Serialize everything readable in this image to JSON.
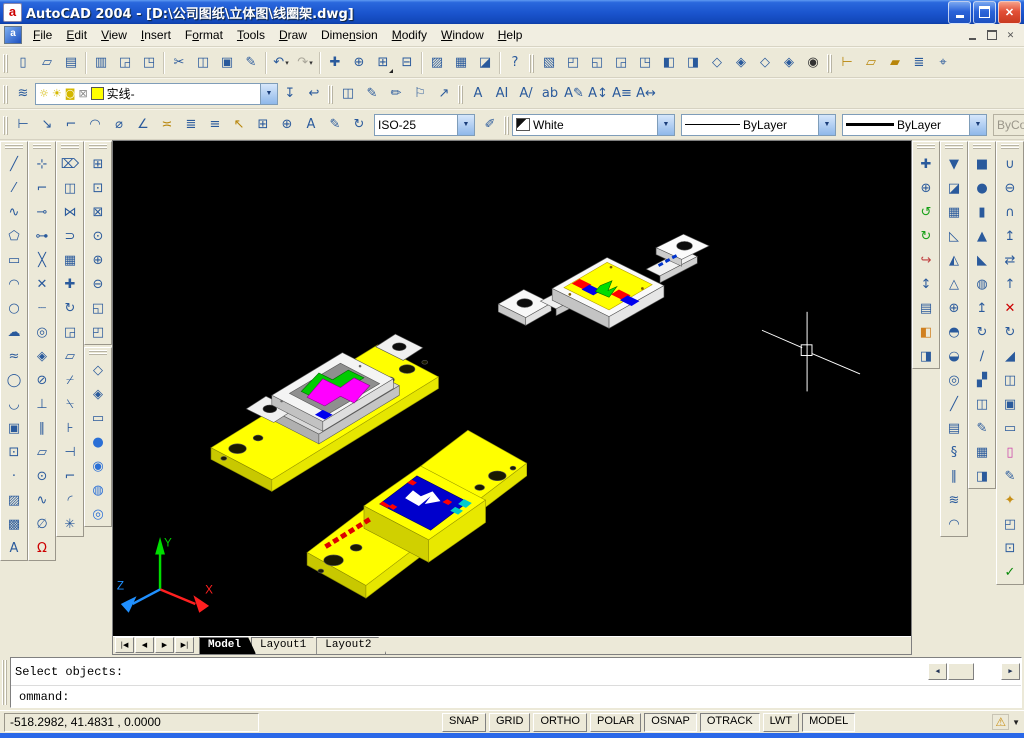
{
  "window": {
    "app_icon_letter": "a",
    "title": "AutoCAD 2004 - [D:\\公司图纸\\立体图\\线圈架.dwg]",
    "controls": {
      "minimize": "minimize",
      "restore": "restore",
      "close": "close"
    }
  },
  "menus": [
    {
      "label": "File",
      "m": 0
    },
    {
      "label": "Edit",
      "m": 0
    },
    {
      "label": "View",
      "m": 0
    },
    {
      "label": "Insert",
      "m": 0
    },
    {
      "label": "Format",
      "m": 1
    },
    {
      "label": "Tools",
      "m": 0
    },
    {
      "label": "Draw",
      "m": 0
    },
    {
      "label": "Dimension",
      "m": 4
    },
    {
      "label": "Modify",
      "m": 0
    },
    {
      "label": "Window",
      "m": 0
    },
    {
      "label": "Help",
      "m": 0
    }
  ],
  "colors": {
    "canvas_bg": "#000000",
    "toolbar_bg": "#ECE9D8",
    "titlebar_blue": "#1A54CD",
    "taskbar_blue": "#2A68E8",
    "model_yellow": "#FFFF00",
    "model_white": "#F5F5F5",
    "model_blue": "#0000CC",
    "model_green": "#00CC00",
    "model_magenta": "#FF00FF",
    "model_red": "#FF0000",
    "ucs_x": "#FF2020",
    "ucs_y": "#00DD00",
    "ucs_z": "#2090FF"
  },
  "toolbars": {
    "standard": [
      {
        "n": "new",
        "g": "▯"
      },
      {
        "n": "open",
        "g": "▱"
      },
      {
        "n": "save",
        "g": "▤"
      },
      {
        "sep": 1
      },
      {
        "n": "plot",
        "g": "▥"
      },
      {
        "n": "plot-preview",
        "g": "◲"
      },
      {
        "n": "publish",
        "g": "◳"
      },
      {
        "sep": 1
      },
      {
        "n": "cut",
        "g": "✂"
      },
      {
        "n": "copy",
        "g": "◫"
      },
      {
        "n": "paste",
        "g": "▣"
      },
      {
        "n": "match-properties",
        "g": "✎"
      },
      {
        "sep": 1
      },
      {
        "n": "undo",
        "g": "↶",
        "dd": 1
      },
      {
        "n": "redo",
        "g": "↷",
        "dd": 1,
        "dis": 1
      },
      {
        "sep": 1
      },
      {
        "n": "pan-realtime",
        "g": "✚"
      },
      {
        "n": "zoom-realtime",
        "g": "⊕"
      },
      {
        "n": "zoom-window",
        "g": "⊞",
        "fly": 1
      },
      {
        "n": "zoom-previous",
        "g": "⊟"
      },
      {
        "sep": 1
      },
      {
        "n": "properties-palette",
        "g": "▨"
      },
      {
        "n": "designcenter",
        "g": "▦"
      },
      {
        "n": "tool-palettes",
        "g": "◪"
      },
      {
        "sep": 1
      },
      {
        "n": "help",
        "g": "?"
      }
    ],
    "views": [
      {
        "n": "named-views",
        "g": "▧"
      },
      {
        "n": "top-view",
        "g": "◰"
      },
      {
        "n": "bottom-view",
        "g": "◱"
      },
      {
        "n": "left-view",
        "g": "◲"
      },
      {
        "n": "right-view",
        "g": "◳"
      },
      {
        "n": "front-view",
        "g": "◧"
      },
      {
        "n": "back-view",
        "g": "◨"
      },
      {
        "n": "sw-isometric-view",
        "g": "◇"
      },
      {
        "n": "se-isometric-view",
        "g": "◈"
      },
      {
        "n": "ne-isometric-view",
        "g": "◇"
      },
      {
        "n": "nw-isometric-view",
        "g": "◈"
      },
      {
        "n": "camera",
        "g": "◉",
        "c": "#333333"
      }
    ],
    "inquiry": [
      {
        "n": "distance",
        "g": "⊢",
        "c": "#b8860b"
      },
      {
        "n": "area",
        "g": "▱",
        "c": "#b8860b"
      },
      {
        "n": "mass-properties",
        "g": "▰",
        "c": "#b8860b"
      },
      {
        "n": "list",
        "g": "≣"
      },
      {
        "n": "locate-point",
        "g": "⌖"
      }
    ],
    "layers_left": [
      {
        "n": "layer-properties-manager",
        "g": "≋"
      }
    ],
    "layers_right": [
      {
        "n": "make-object-layer-current",
        "g": "↧"
      },
      {
        "n": "layer-previous",
        "g": "↩"
      }
    ],
    "propref": [
      {
        "n": "object-properties",
        "g": "◫"
      },
      {
        "n": "edit-attribute",
        "g": "✎"
      },
      {
        "n": "block-attribute-manager",
        "g": "✏"
      },
      {
        "n": "define-attribute",
        "g": "⚐"
      },
      {
        "n": "synchronize-attributes",
        "g": "↗"
      }
    ],
    "text": [
      {
        "n": "multiline-text",
        "g": "A"
      },
      {
        "n": "single-line-text",
        "g": "AI"
      },
      {
        "n": "edit-text",
        "g": "A/"
      },
      {
        "n": "find-and-replace",
        "g": "ab"
      },
      {
        "n": "text-style",
        "g": "A✎"
      },
      {
        "n": "scale-text",
        "g": "A↕"
      },
      {
        "n": "justify-text",
        "g": "A≡"
      },
      {
        "n": "convert-distance",
        "g": "A↔"
      }
    ],
    "dimension": [
      {
        "n": "linear-dimension",
        "g": "⊢"
      },
      {
        "n": "aligned-dimension",
        "g": "↘"
      },
      {
        "n": "ordinate-dimension",
        "g": "⌐"
      },
      {
        "n": "radius-dimension",
        "g": "◠"
      },
      {
        "n": "diameter-dimension",
        "g": "⌀"
      },
      {
        "n": "angular-dimension",
        "g": "∠"
      },
      {
        "n": "quick-dimension",
        "g": "≍",
        "c": "#b8860b"
      },
      {
        "n": "baseline-dimension",
        "g": "≣"
      },
      {
        "n": "continue-dimension",
        "g": "≡"
      },
      {
        "n": "quick-leader",
        "g": "↖",
        "c": "#b8860b"
      },
      {
        "n": "tolerance",
        "g": "⊞"
      },
      {
        "n": "center-mark",
        "g": "⊕"
      },
      {
        "n": "dimension-edit",
        "g": "A"
      },
      {
        "n": "dimension-text-edit",
        "g": "✎"
      },
      {
        "n": "dimension-update",
        "g": "↻"
      }
    ],
    "dim_style_btn": [
      {
        "n": "dimension-style",
        "g": "✐"
      }
    ],
    "draw": [
      {
        "n": "line",
        "g": "╱"
      },
      {
        "n": "construction-line",
        "g": "⁄"
      },
      {
        "n": "polyline",
        "g": "∿"
      },
      {
        "n": "polygon",
        "g": "⬠"
      },
      {
        "n": "rectangle",
        "g": "▭"
      },
      {
        "n": "arc",
        "g": "◠"
      },
      {
        "n": "circle",
        "g": "○"
      },
      {
        "n": "revision-cloud",
        "g": "☁"
      },
      {
        "n": "spline",
        "g": "≈"
      },
      {
        "n": "ellipse",
        "g": "◯"
      },
      {
        "n": "ellipse-arc",
        "g": "◡"
      },
      {
        "n": "insert-block",
        "g": "▣"
      },
      {
        "n": "make-block",
        "g": "⊡"
      },
      {
        "n": "point",
        "g": "·"
      },
      {
        "n": "hatch",
        "g": "▨"
      },
      {
        "n": "region",
        "g": "▩"
      },
      {
        "n": "multiline-text-draw",
        "g": "A"
      }
    ],
    "osnap": [
      {
        "n": "temporary-tracking-point",
        "g": "⊹"
      },
      {
        "n": "snap-from",
        "g": "⌐"
      },
      {
        "n": "snap-endpoint",
        "g": "⊸"
      },
      {
        "n": "snap-midpoint",
        "g": "⊶"
      },
      {
        "n": "snap-intersection",
        "g": "╳"
      },
      {
        "n": "snap-apparent-intersection",
        "g": "✕"
      },
      {
        "n": "snap-extension",
        "g": "┈"
      },
      {
        "n": "snap-center",
        "g": "◎"
      },
      {
        "n": "snap-quadrant",
        "g": "◈"
      },
      {
        "n": "snap-tangent",
        "g": "⊘"
      },
      {
        "n": "snap-perpendicular",
        "g": "⊥"
      },
      {
        "n": "snap-parallel",
        "g": "∥"
      },
      {
        "n": "snap-insertion",
        "g": "▱"
      },
      {
        "n": "snap-node",
        "g": "⊙"
      },
      {
        "n": "snap-nearest",
        "g": "∿"
      },
      {
        "n": "snap-none",
        "g": "∅"
      },
      {
        "n": "osnap-settings",
        "g": "Ω",
        "c": "#cc0000"
      }
    ],
    "modify": [
      {
        "n": "erase",
        "g": "⌦"
      },
      {
        "n": "copy-object",
        "g": "◫"
      },
      {
        "n": "mirror",
        "g": "⋈"
      },
      {
        "n": "offset",
        "g": "⊃"
      },
      {
        "n": "array",
        "g": "▦"
      },
      {
        "n": "move",
        "g": "✚"
      },
      {
        "n": "rotate",
        "g": "↻"
      },
      {
        "n": "scale",
        "g": "◲"
      },
      {
        "n": "stretch",
        "g": "▱"
      },
      {
        "n": "trim",
        "g": "⌿"
      },
      {
        "n": "extend",
        "g": "⍀"
      },
      {
        "n": "break-at-point",
        "g": "⊦"
      },
      {
        "n": "break",
        "g": "⊣"
      },
      {
        "n": "chamfer",
        "g": "⌐"
      },
      {
        "n": "fillet",
        "g": "◜"
      },
      {
        "n": "explode",
        "g": "✳"
      }
    ],
    "zoom": [
      {
        "n": "zoom-window-tool",
        "g": "⊞"
      },
      {
        "n": "zoom-dynamic",
        "g": "⊡"
      },
      {
        "n": "zoom-scale",
        "g": "⊠"
      },
      {
        "n": "zoom-center",
        "g": "⊙"
      },
      {
        "n": "zoom-in",
        "g": "⊕"
      },
      {
        "n": "zoom-out",
        "g": "⊖"
      },
      {
        "n": "zoom-all",
        "g": "◱"
      },
      {
        "n": "zoom-extents",
        "g": "◰"
      }
    ],
    "shade": [
      {
        "n": "2d-wireframe",
        "g": "◇"
      },
      {
        "n": "3d-wireframe",
        "g": "◈"
      },
      {
        "n": "hidden",
        "g": "▭"
      },
      {
        "n": "flat-shaded",
        "g": "●",
        "c": "#2a6fd6"
      },
      {
        "n": "gouraud-shaded",
        "g": "◉",
        "c": "#2a6fd6"
      },
      {
        "n": "flat-shaded-edges-on",
        "g": "◍",
        "c": "#2a6fd6"
      },
      {
        "n": "gouraud-shaded-edges-on",
        "g": "◎",
        "c": "#2a6fd6"
      }
    ],
    "orbit3d": [
      {
        "n": "3d-pan",
        "g": "✚"
      },
      {
        "n": "3d-zoom",
        "g": "⊕"
      },
      {
        "n": "3d-orbit",
        "g": "↺",
        "c": "#18a018"
      },
      {
        "n": "3d-continuous-orbit",
        "g": "↻",
        "c": "#18a018"
      },
      {
        "n": "3d-swivel",
        "g": "↪",
        "c": "#c04040"
      },
      {
        "n": "3d-adjust-distance",
        "g": "↕"
      },
      {
        "n": "3d-adjust-clip-planes",
        "g": "▤"
      },
      {
        "n": "front-clip-on-off",
        "g": "◧",
        "c": "#d08020"
      },
      {
        "n": "back-clip-on-off",
        "g": "◨"
      }
    ],
    "surfaces": [
      {
        "n": "2d-solid",
        "g": "▼"
      },
      {
        "n": "3d-face",
        "g": "◪"
      },
      {
        "n": "box-surface",
        "g": "▦"
      },
      {
        "n": "wedge-surface",
        "g": "◺"
      },
      {
        "n": "pyramid",
        "g": "◭"
      },
      {
        "n": "cone-surface",
        "g": "△"
      },
      {
        "n": "sphere-surface",
        "g": "⊕"
      },
      {
        "n": "dome",
        "g": "◓"
      },
      {
        "n": "dish",
        "g": "◒"
      },
      {
        "n": "torus-surface",
        "g": "◎"
      },
      {
        "n": "edge",
        "g": "╱"
      },
      {
        "n": "3d-mesh",
        "g": "▤"
      },
      {
        "n": "revolved-surface",
        "g": "§"
      },
      {
        "n": "tabulated-surface",
        "g": "∥"
      },
      {
        "n": "ruled-surface",
        "g": "≋"
      },
      {
        "n": "edge-surface",
        "g": "◠"
      }
    ],
    "solids": [
      {
        "n": "box",
        "g": "■"
      },
      {
        "n": "sphere",
        "g": "●"
      },
      {
        "n": "cylinder",
        "g": "▮"
      },
      {
        "n": "cone",
        "g": "▲"
      },
      {
        "n": "wedge",
        "g": "◣"
      },
      {
        "n": "torus",
        "g": "◍"
      },
      {
        "n": "extrude",
        "g": "↥"
      },
      {
        "n": "revolve",
        "g": "↻"
      },
      {
        "n": "slice",
        "g": "∕"
      },
      {
        "n": "section",
        "g": "▞"
      },
      {
        "n": "interfere",
        "g": "◫"
      },
      {
        "n": "setup-drawing",
        "g": "✎"
      },
      {
        "n": "setup-view",
        "g": "▦"
      },
      {
        "n": "setup-profile",
        "g": "◨"
      }
    ],
    "solids_editing": [
      {
        "n": "union",
        "g": "∪"
      },
      {
        "n": "subtract",
        "g": "⊖"
      },
      {
        "n": "intersect",
        "g": "∩"
      },
      {
        "n": "extrude-faces",
        "g": "↥"
      },
      {
        "n": "move-faces",
        "g": "⇄"
      },
      {
        "n": "offset-faces",
        "g": "↑"
      },
      {
        "n": "delete-faces",
        "g": "✕",
        "c": "#cc0000"
      },
      {
        "n": "rotate-faces",
        "g": "↻"
      },
      {
        "n": "taper-faces",
        "g": "◢"
      },
      {
        "n": "copy-faces",
        "g": "◫"
      },
      {
        "n": "color-faces",
        "g": "▣"
      },
      {
        "n": "copy-edges",
        "g": "▭"
      },
      {
        "n": "color-edges",
        "g": "▯",
        "c": "#cc44aa"
      },
      {
        "n": "imprint",
        "g": "✎"
      },
      {
        "n": "clean",
        "g": "✦",
        "c": "#c89018"
      },
      {
        "n": "separate",
        "g": "◰"
      },
      {
        "n": "shell",
        "g": "⊡"
      },
      {
        "n": "check",
        "g": "✓",
        "c": "#0a8a0a"
      }
    ]
  },
  "combos": {
    "layer": {
      "value": "实线-",
      "swatch": "#FFFF00"
    },
    "dim_style": {
      "value": "ISO-25"
    },
    "color": {
      "value": "White",
      "swatch": "#FFFFFF"
    },
    "linetype": {
      "value": "ByLayer"
    },
    "lineweight": {
      "value": "ByLayer"
    },
    "plot_style": {
      "value": "ByColor",
      "disabled": true
    }
  },
  "ucs": {
    "x_label": "X",
    "y_label": "Y",
    "z_label": "Z"
  },
  "model_tabs": {
    "nav": [
      {
        "n": "first-tab",
        "g": "|◀"
      },
      {
        "n": "previous-tab",
        "g": "◀"
      },
      {
        "n": "next-tab",
        "g": "▶"
      },
      {
        "n": "last-tab",
        "g": "▶|"
      }
    ],
    "tabs": [
      {
        "label": "Model",
        "active": true
      },
      {
        "label": "Layout1",
        "active": false
      },
      {
        "label": "Layout2",
        "active": false
      }
    ]
  },
  "command": {
    "line1": "Select objects:",
    "line2": "ommand:"
  },
  "status": {
    "coordinates": "-518.2982, 41.4831  , 0.0000",
    "toggles": [
      {
        "label": "SNAP",
        "on": false
      },
      {
        "label": "GRID",
        "on": false
      },
      {
        "label": "ORTHO",
        "on": false
      },
      {
        "label": "POLAR",
        "on": false
      },
      {
        "label": "OSNAP",
        "on": true
      },
      {
        "label": "OTRACK",
        "on": true
      },
      {
        "label": "LWT",
        "on": false
      },
      {
        "label": "MODEL",
        "on": true
      }
    ],
    "tray_icon": "communication-center"
  }
}
